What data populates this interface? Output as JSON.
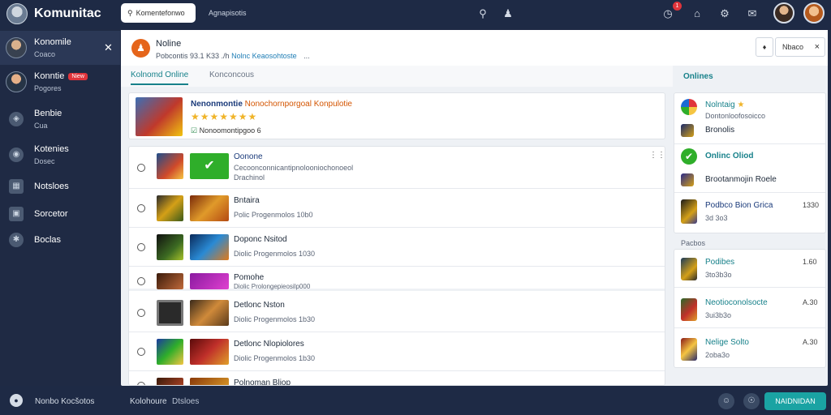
{
  "app": {
    "name": "Komunitac"
  },
  "search": {
    "value": "Komentefonwo"
  },
  "topbar": {
    "subtitle": "Agnapisotis",
    "badge": "1"
  },
  "sidebar": {
    "items": [
      {
        "title": "Konomile",
        "sub": "Coaco",
        "icon": "avatar"
      },
      {
        "title": "Konntie",
        "sub": "Pogores",
        "tag": "Niew",
        "icon": "avatar"
      },
      {
        "title": "Benbie",
        "sub": "Cua",
        "icon": "tag-icon"
      },
      {
        "title": "Kotenies",
        "sub": "Dosec",
        "icon": "disc-icon"
      },
      {
        "title": "Notsloes",
        "icon": "bookmark-icon"
      },
      {
        "title": "Sorcetor",
        "icon": "box-icon"
      },
      {
        "title": "Boclas",
        "icon": "puzzle-icon"
      }
    ]
  },
  "header": {
    "title": "Noline",
    "meta": "Pobcontis 93.1 K33 ./h",
    "link": "Nolnc Keaosohtoste",
    "more": "...",
    "btn_small": "♦",
    "btn_label": "Nbaco",
    "close": "×"
  },
  "tabs": [
    {
      "label": "Kolnomd Online",
      "active": true
    },
    {
      "label": "Konconcous",
      "active": false
    }
  ],
  "featured": {
    "title": "Nenonmontie",
    "title_accent": "Nonochornporgoal Konpulotie",
    "stars": "★★★★★★★",
    "meta": "Nonoomontipgoo 6"
  },
  "list": [
    {
      "title": "Oonone",
      "sub": "Cecoonconnicantipnolooniochonoeol",
      "sub2": "Drachinol",
      "has_check": true
    },
    {
      "title": "Bntaira",
      "sub": "Polic Progenmolos 10b0"
    },
    {
      "title": "Doponc Nsitod",
      "sub": "Diolic Progenmolos 1030"
    },
    {
      "title": "Pomohe",
      "sub": "Diolic Prolongepieosilp000"
    },
    {
      "title": "Detlonc Nston",
      "sub": "Diolic Progenmolos 1b30"
    },
    {
      "title": "Detlonc Nlopiolores",
      "sub": "Diolic Progenmolos 1b30"
    },
    {
      "title": "Polnoman Bliop",
      "sub": ""
    }
  ],
  "right": {
    "header": "Onlines",
    "top": [
      {
        "label": "Nolntaig",
        "sub": "Dontonloofosoicco",
        "star": "★"
      },
      {
        "label": "Bronolis"
      },
      {
        "label": "Onlinc Oliod",
        "teal": true
      },
      {
        "label": "Brootanmojin Roele"
      },
      {
        "label": "Podbco Bion Grica",
        "sub": "3d 3o3",
        "num": "1330"
      }
    ],
    "section_label": "Pacbos",
    "bottom": [
      {
        "label": "Podibes",
        "sub": "3to3b3o",
        "num": "1.60"
      },
      {
        "label": "Neotioconolsocte",
        "sub": "3ui3b3o",
        "num": "A.30"
      },
      {
        "label": "Nelige Solto",
        "sub": "2oba3o",
        "num": "A.30"
      }
    ]
  },
  "bottombar": {
    "user": "Nonbo Kocšotos",
    "link1": "Kolohoure",
    "link2": "Dtsloes",
    "send": "NAIDNIDAN"
  },
  "colors": {
    "accent": "#17818a",
    "sidebar": "#1f2a44",
    "send": "#1aa3a3"
  }
}
